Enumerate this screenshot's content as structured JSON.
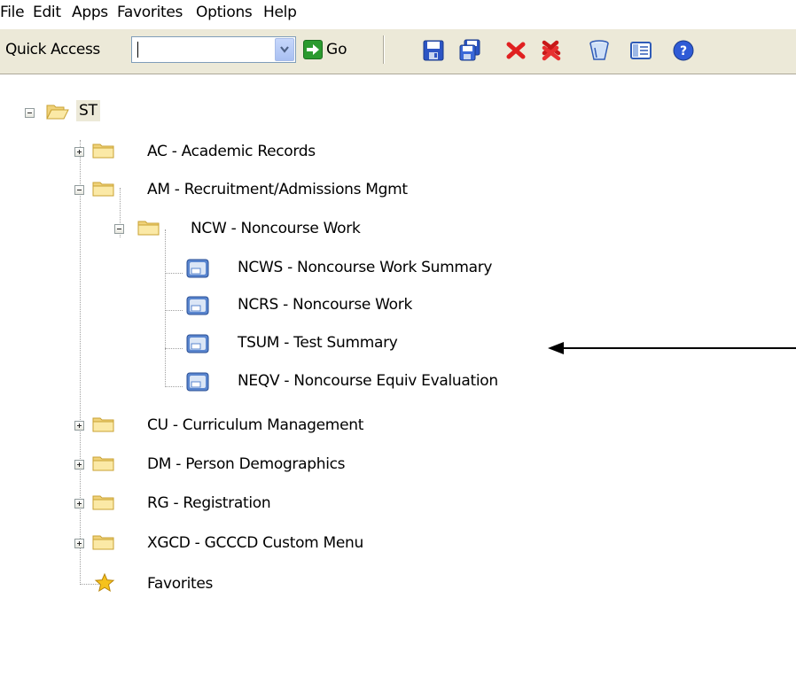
{
  "menu": [
    "File",
    "Edit",
    "Apps",
    "Favorites",
    "Options",
    "Help"
  ],
  "toolbar": {
    "quick_access_label": "Quick Access",
    "quick_access_value": "",
    "go_label": "Go"
  },
  "tree": {
    "root": "ST",
    "items": [
      {
        "label": "AC - Academic Records"
      },
      {
        "label": "AM - Recruitment/Admissions Mgmt"
      },
      {
        "label": "NCW - Noncourse Work"
      },
      {
        "label": "NCWS - Noncourse Work Summary"
      },
      {
        "label": "NCRS - Noncourse Work"
      },
      {
        "label": "TSUM - Test Summary"
      },
      {
        "label": "NEQV - Noncourse Equiv Evaluation"
      },
      {
        "label": "CU - Curriculum Management"
      },
      {
        "label": "DM - Person Demographics"
      },
      {
        "label": "RG - Registration"
      },
      {
        "label": "XGCD - GCCCD Custom Menu"
      },
      {
        "label": "Favorites"
      }
    ]
  },
  "icons": {
    "save": "save-icon",
    "save_all": "save-all-icon",
    "delete": "delete-icon",
    "delete_all": "delete-all-icon",
    "clear": "clear-bucket-icon",
    "form": "form-icon",
    "help": "help-icon"
  }
}
